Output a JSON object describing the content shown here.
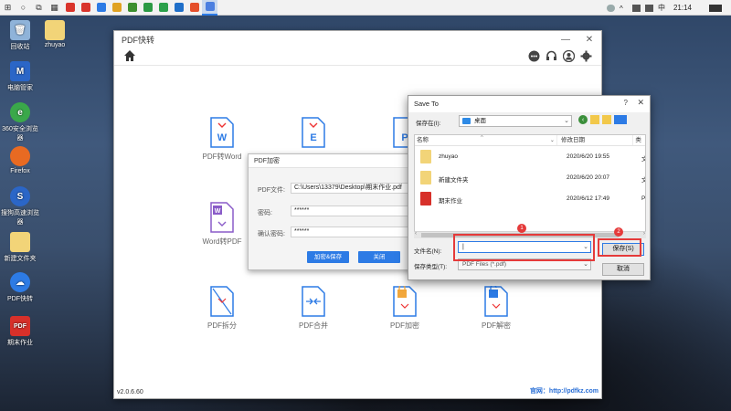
{
  "taskbar": {
    "apps": [
      {
        "name": "app-1",
        "color": "#d9342b"
      },
      {
        "name": "app-2",
        "color": "#d9342b"
      },
      {
        "name": "app-3",
        "color": "#2d7be5"
      },
      {
        "name": "app-4",
        "color": "#e0a221"
      },
      {
        "name": "app-5",
        "color": "#3c8f2f"
      },
      {
        "name": "app-6",
        "color": "#2b9a44"
      },
      {
        "name": "app-7",
        "color": "#2ba04a"
      },
      {
        "name": "app-8",
        "color": "#1f6fc9"
      },
      {
        "name": "app-9",
        "color": "#e54f2b"
      },
      {
        "name": "app-10",
        "color": "#4b7fe0"
      }
    ],
    "clock": "21:14",
    "ime": "中"
  },
  "desktop": {
    "icons": [
      {
        "label": "回收站",
        "color": "#8fb3d9"
      },
      {
        "label": "zhuyao",
        "color": "#f2d478"
      },
      {
        "label": "电脑管家",
        "color": "#2b66c7"
      },
      {
        "label": "360安全浏览器",
        "color": "#3aa84a"
      },
      {
        "label": "Firefox",
        "color": "#e86a22"
      },
      {
        "label": "搜狗高速浏览器",
        "color": "#2b66c7"
      },
      {
        "label": "新建文件夹",
        "color": "#f2d478"
      },
      {
        "label": "PDF快转",
        "color": "#2d7be5"
      },
      {
        "label": "期末作业",
        "color": "#d7302a"
      }
    ]
  },
  "app": {
    "title": "PDF快转",
    "version": "v2.0.6.60",
    "website": "官网：http://pdfkz.com",
    "tools": [
      {
        "label": "PDF转Word",
        "letter": "W",
        "color": "#2d7be5"
      },
      {
        "label": "",
        "letter": "E",
        "color": "#2d7be5"
      },
      {
        "label": "",
        "letter": "P",
        "color": "#2d7be5"
      },
      {
        "label": "Word转PDF",
        "letter": "W",
        "color": "#8a5cc8"
      },
      {
        "label": "PDF拆分",
        "letter": "",
        "color": "#2d7be5"
      },
      {
        "label": "PDF合并",
        "letter": "",
        "color": "#2d7be5"
      },
      {
        "label": "PDF加密",
        "letter": "",
        "color": "#f2a73b"
      },
      {
        "label": "PDF解密",
        "letter": "",
        "color": "#2d7be5"
      }
    ]
  },
  "encrypt_dialog": {
    "title": "PDF加密",
    "file_label": "PDF文件:",
    "file_value": "C:\\Users\\13379\\Desktop\\期末作业.pdf",
    "password_label": "密码:",
    "password_value": "******",
    "confirm_label": "确认密码:",
    "confirm_value": "******",
    "encrypt_save_label": "加密&保存",
    "close_label": "关闭"
  },
  "save_dialog": {
    "title": "Save To",
    "help": "?",
    "save_in_label": "保存在(I):",
    "save_in_value": "桌面",
    "columns": {
      "name": "名称",
      "date": "修改日期",
      "type": "类"
    },
    "files": [
      {
        "name": "zhuyao",
        "date": "2020/6/20 19:55",
        "type": "文",
        "icon_color": "#f2d478"
      },
      {
        "name": "新建文件夹",
        "date": "2020/6/20 20:07",
        "type": "文",
        "icon_color": "#f2d478"
      },
      {
        "name": "期末作业",
        "date": "2020/6/12 17:49",
        "type": "P",
        "icon_color": "#d7302a"
      }
    ],
    "filename_label": "文件名(N):",
    "filename_value": "|",
    "filetype_label": "保存类型(T):",
    "filetype_value": "PDF Files (*.pdf)",
    "save_label": "保存(S)",
    "cancel_label": "取消",
    "badges": [
      "1",
      "2"
    ]
  }
}
